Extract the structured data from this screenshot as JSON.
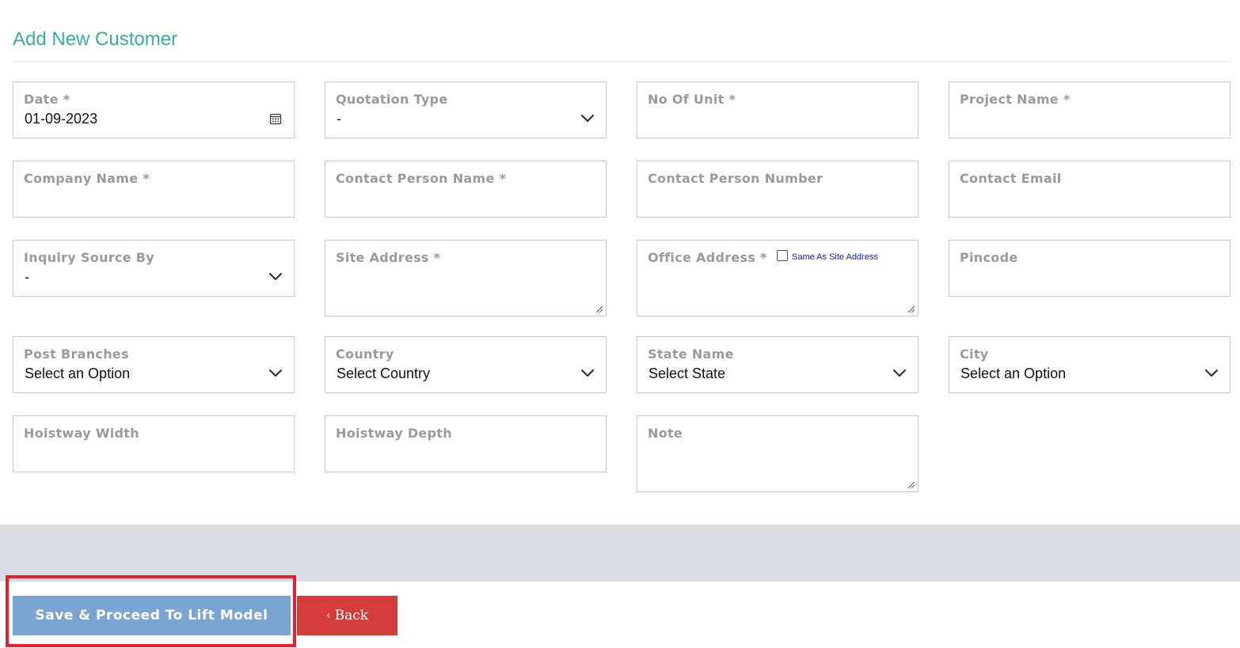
{
  "page": {
    "title": "Add New Customer"
  },
  "form": {
    "date": {
      "label": "Date *",
      "value": "01-09-2023",
      "icon": "calendar-icon"
    },
    "quotation_type": {
      "label": "Quotation Type",
      "value": "-"
    },
    "no_of_unit": {
      "label": "No Of Unit *",
      "value": ""
    },
    "project_name": {
      "label": "Project Name *",
      "value": ""
    },
    "company_name": {
      "label": "Company Name *",
      "value": ""
    },
    "contact_person_name": {
      "label": "Contact Person Name *",
      "value": ""
    },
    "contact_person_number": {
      "label": "Contact Person Number",
      "value": ""
    },
    "contact_email": {
      "label": "Contact Email",
      "value": ""
    },
    "inquiry_source_by": {
      "label": "Inquiry Source By",
      "value": "-"
    },
    "site_address": {
      "label": "Site Address *",
      "value": ""
    },
    "office_address": {
      "label": "Office Address *",
      "value": "",
      "same_as_label": "Same As Site Address",
      "same_as_checked": false
    },
    "pincode": {
      "label": "Pincode",
      "value": ""
    },
    "post_branches": {
      "label": "Post Branches",
      "value": "Select an Option"
    },
    "country": {
      "label": "Country",
      "value": "Select Country"
    },
    "state_name": {
      "label": "State Name",
      "value": "Select State"
    },
    "city": {
      "label": "City",
      "value": "Select an Option"
    },
    "hoistway_width": {
      "label": "Hoistway Width",
      "value": ""
    },
    "hoistway_depth": {
      "label": "Hoistway Depth",
      "value": ""
    },
    "note": {
      "label": "Note",
      "value": ""
    }
  },
  "actions": {
    "save_label": "Save & Proceed To Lift Model",
    "back_label": "Back",
    "back_icon": "chevron-left-icon",
    "highlight_color": "#e8202e",
    "save_color": "#7aa5d2",
    "back_color": "#d63c39"
  },
  "colors": {
    "title": "#3aaca0",
    "label": "#9a9a9a",
    "band": "#d9dde3"
  }
}
